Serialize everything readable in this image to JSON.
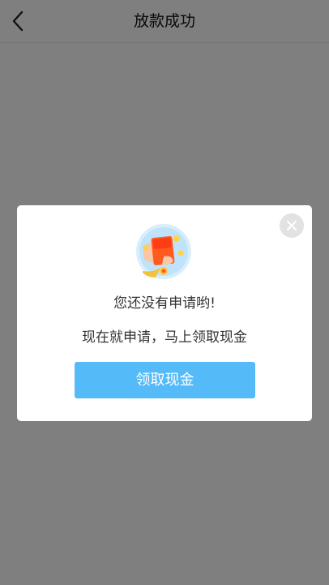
{
  "navbar": {
    "title": "放款成功",
    "back_icon": "chevron-left-icon"
  },
  "modal": {
    "illustration_icon": "red-envelope-icon",
    "close_icon": "close-icon",
    "message": "您还没有申请哟!",
    "sub_message": "现在就申请，马上领取现金",
    "button_label": "领取现金"
  },
  "colors": {
    "overlay": "#808080",
    "button": "#55baf8",
    "modal_bg": "#ffffff",
    "close_bg": "#e2e2e2",
    "envelope": "#ff5a1f"
  }
}
